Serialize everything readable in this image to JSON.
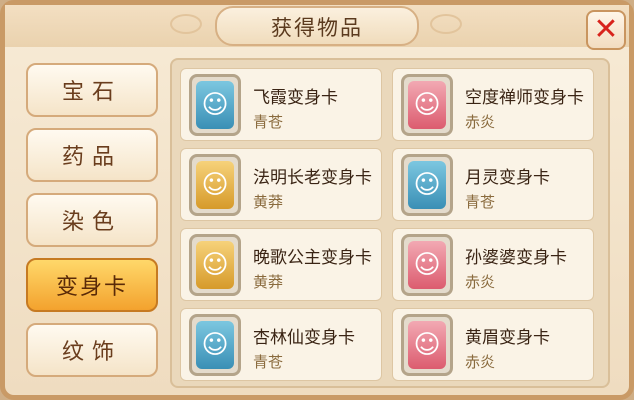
{
  "window": {
    "title": "获得物品",
    "close_icon": "close-x-icon"
  },
  "colors": {
    "green": "#4aa8c9",
    "gold": "#e0a43a",
    "red": "#e46a7a"
  },
  "tabs": [
    {
      "label": "宝石",
      "active": false
    },
    {
      "label": "药品",
      "active": false
    },
    {
      "label": "染色",
      "active": false
    },
    {
      "label": "变身卡",
      "active": true
    },
    {
      "label": "纹饰",
      "active": false
    }
  ],
  "cards": [
    {
      "name": "飞霞变身卡",
      "sub": "青苍",
      "icon": "portrait-icon"
    },
    {
      "name": "空度禅师变身卡",
      "sub": "赤炎",
      "icon": "portrait-icon"
    },
    {
      "name": "法明长老变身卡",
      "sub": "黄莽",
      "icon": "portrait-icon"
    },
    {
      "name": "月灵变身卡",
      "sub": "青苍",
      "icon": "portrait-icon"
    },
    {
      "name": "晚歌公主变身卡",
      "sub": "黄莽",
      "icon": "portrait-icon"
    },
    {
      "name": "孙婆婆变身卡",
      "sub": "赤炎",
      "icon": "portrait-icon"
    },
    {
      "name": "杏林仙变身卡",
      "sub": "青苍",
      "icon": "portrait-icon"
    },
    {
      "name": "黄眉变身卡",
      "sub": "赤炎",
      "icon": "portrait-icon"
    }
  ]
}
